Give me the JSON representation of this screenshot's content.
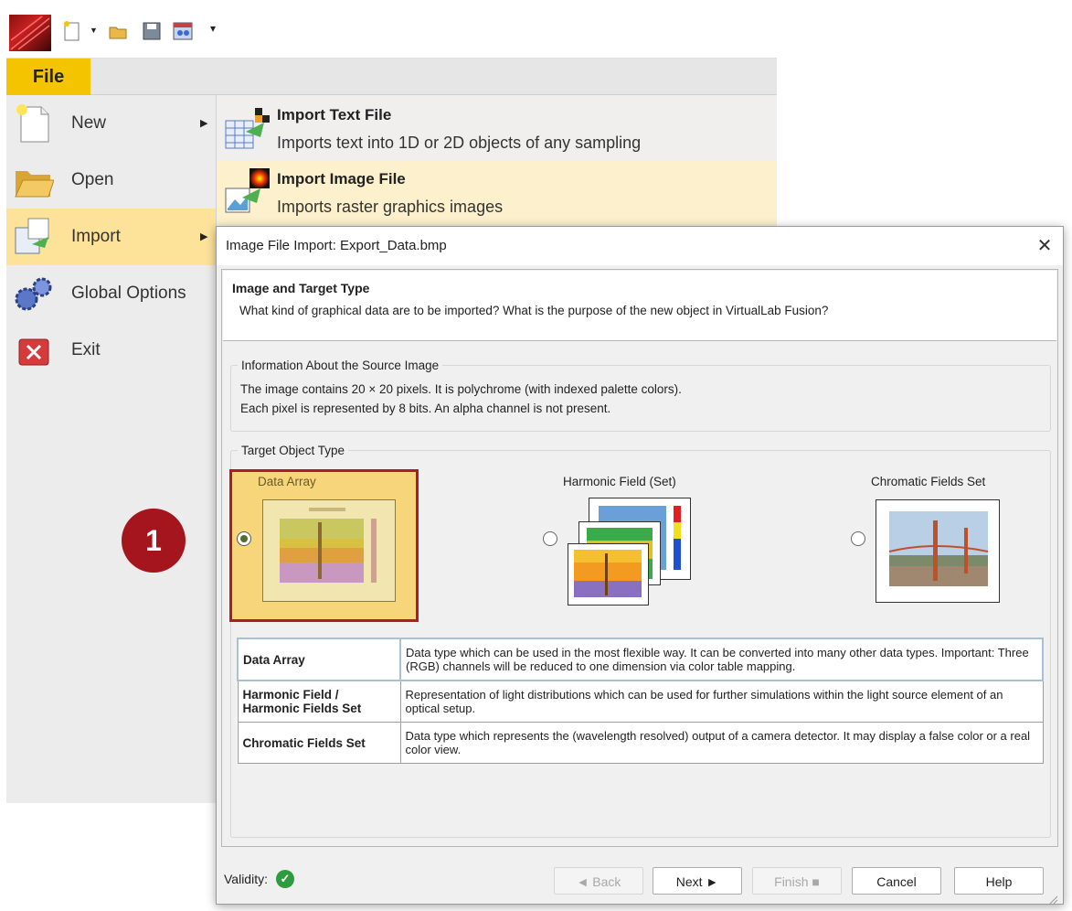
{
  "file_tab": "File",
  "left_menu": {
    "items": [
      {
        "label": "New",
        "icon": "new-document-icon",
        "has_submenu": true
      },
      {
        "label": "Open",
        "icon": "folder-open-icon",
        "has_submenu": false
      },
      {
        "label": "Import",
        "icon": "import-icon",
        "has_submenu": true,
        "active": true
      },
      {
        "label": "Global Options",
        "icon": "gears-icon",
        "has_submenu": false
      },
      {
        "label": "Exit",
        "icon": "exit-icon",
        "has_submenu": false
      }
    ]
  },
  "import_submenu": {
    "items": [
      {
        "title": "Import Text File",
        "desc": "Imports text into 1D or 2D objects of any sampling",
        "icon": "text-file-import-icon"
      },
      {
        "title": "Import Image File",
        "desc": "Imports raster graphics images",
        "icon": "image-file-import-icon"
      }
    ]
  },
  "step_badge": "1",
  "dialog": {
    "title": "Image File Import: Export_Data.bmp",
    "close_glyph": "✕",
    "header": {
      "title": "Image and Target Type",
      "description": "What kind of graphical data are to be imported? What is the purpose of the new object in VirtualLab Fusion?"
    },
    "source_info": {
      "group_title": "Information About the Source Image",
      "line1": "The image contains 20 × 20 pixels. It is polychrome (with indexed palette colors).",
      "line2": "Each pixel is represented by 8 bits. An alpha channel is not present."
    },
    "target": {
      "group_title": "Target Object Type",
      "options": [
        {
          "label": "Data Array",
          "selected": true
        },
        {
          "label": "Harmonic Field (Set)",
          "selected": false
        },
        {
          "label": "Chromatic Fields Set",
          "selected": false
        }
      ]
    },
    "descriptions": [
      {
        "name": "Data Array",
        "text": "Data type which can be used in the most flexible way. It can be converted into many other data types. Important: Three (RGB) channels will be reduced to one dimension via color table mapping."
      },
      {
        "name": "Harmonic Field / Harmonic Fields Set",
        "text": "Representation of light distributions which can be used for further simulations within the light source element of an optical setup."
      },
      {
        "name": "Chromatic Fields Set",
        "text": "Data type which represents the (wavelength resolved) output of a camera detector. It may display a false color or a real color view."
      }
    ],
    "validity_label": "Validity:",
    "buttons": {
      "back": "◄ Back",
      "next": "Next ►",
      "finish": "Finish ■",
      "cancel": "Cancel",
      "help": "Help"
    }
  },
  "colors": {
    "file_tab": "#f5c400",
    "highlight": "#fde39a",
    "selected_border": "#b01c23",
    "badge": "#a5151e"
  }
}
